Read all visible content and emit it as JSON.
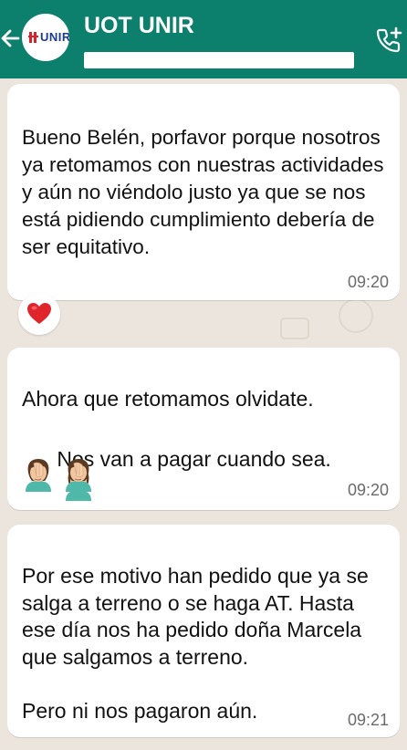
{
  "header": {
    "contact_name": "UOT UNIR",
    "avatar_logo_text": "UNIR",
    "background_color": "#0c806d"
  },
  "messages": [
    {
      "text": "Bueno Belén, porfavor porque nosotros ya retomamos con nuestras actividades y aún no viéndolo justo ya que se nos está pidiendo cumplimiento debería de ser equitativo.",
      "time": "09:20",
      "reaction": "red-heart"
    },
    {
      "text_line1": "Ahora que retomamos olvidate.",
      "text_line2": "Nos van a pagar cuando sea.",
      "trailing_emojis": [
        "woman-facepalming",
        "woman-facepalming",
        "woman-facepalming"
      ],
      "time": "09:20"
    },
    {
      "text": "Por ese motivo han pedido que ya se salga a terreno o se haga AT. Hasta ese día nos ha pedido doña Marcela que salgamos a terreno.\n\nPero ni nos pagaron aún.",
      "time": "09:21"
    }
  ],
  "icons": {
    "back": "arrow-left-icon",
    "call": "add-call-icon",
    "reaction": "heart-icon",
    "emoji": "facepalm-emoji"
  }
}
